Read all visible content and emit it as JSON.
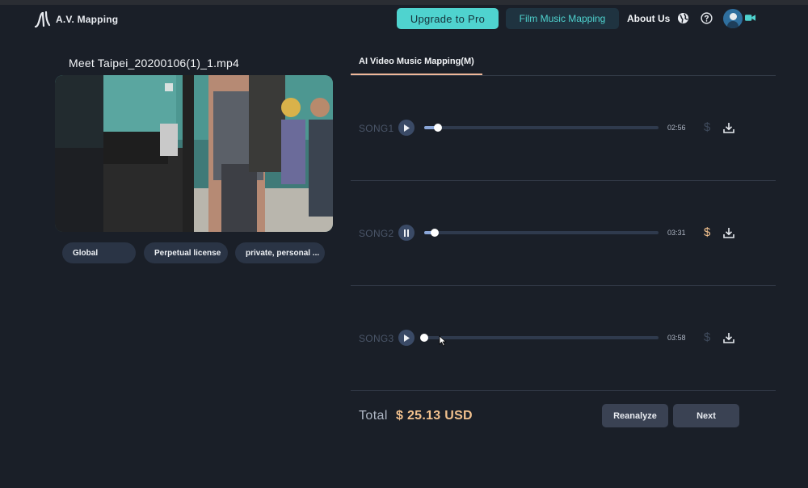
{
  "header": {
    "logo_text": "A.V. Mapping",
    "upgrade_label": "Upgrade to Pro",
    "film_label": "Film Music Mapping",
    "about_label": "About Us"
  },
  "video": {
    "filename": "Meet Taipei_20200106(1)_1.mp4",
    "tags": [
      "Global",
      "Perpetual license",
      "private, personal ..."
    ]
  },
  "tab": {
    "label": "AI Video Music Mapping(M)"
  },
  "songs": [
    {
      "label": "SONG1",
      "state": "play",
      "progress": 0.06,
      "duration": "02:56",
      "price_symbol": "$",
      "price_active": false
    },
    {
      "label": "SONG2",
      "state": "pause",
      "progress": 0.045,
      "duration": "03:31",
      "price_symbol": "$",
      "price_active": true
    },
    {
      "label": "SONG3",
      "state": "play",
      "progress": 0.0,
      "duration": "03:58",
      "price_symbol": "$",
      "price_active": false
    }
  ],
  "total": {
    "label": "Total",
    "amount": "$ 25.13 USD"
  },
  "actions": {
    "reanalyze_label": "Reanalyze",
    "next_label": "Next"
  },
  "colors": {
    "accent_teal": "#4fd3cf",
    "price_active": "#f2c18e",
    "price_inactive": "#3f4a5c",
    "background": "#1a1f28"
  }
}
